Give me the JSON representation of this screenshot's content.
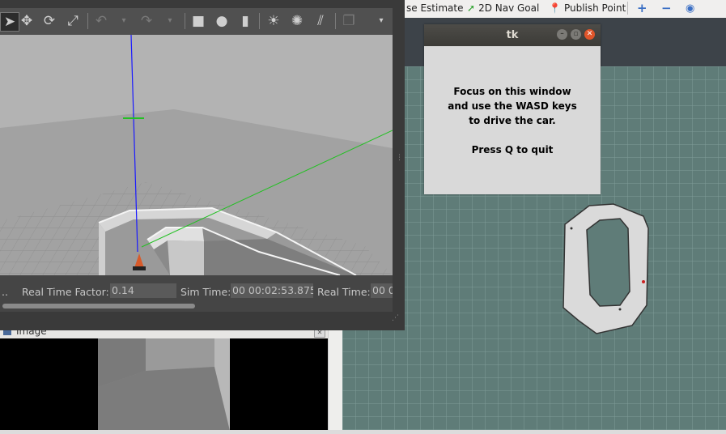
{
  "rviz": {
    "toolbar": {
      "pose_estimate_label": "se Estimate",
      "nav_goal_label": "2D Nav Goal",
      "publish_point_label": "Publish Point",
      "add_icon": "plus-icon",
      "remove_icon": "minus-icon",
      "view_icon": "eye-icon"
    },
    "grid_color": "#5f7c78",
    "track_color": "#d8d8d8"
  },
  "image_panel": {
    "title": "Image",
    "close_label": "✕"
  },
  "gazebo": {
    "toolbar": {
      "icons": [
        "select-arrow-icon",
        "translate-icon",
        "rotate-icon",
        "scale-icon",
        "undo-icon",
        "redo-icon",
        "box-icon",
        "sphere-icon",
        "cylinder-icon",
        "point-light-icon",
        "spot-light-icon",
        "directional-light-icon",
        "copy-icon"
      ]
    },
    "status": {
      "pause_label": "..",
      "real_time_factor_label": "Real Time Factor:",
      "real_time_factor_value": "0.14",
      "sim_time_label": "Sim Time:",
      "sim_time_value": "00 00:02:53.875",
      "real_time_label": "Real Time:",
      "real_time_value": "00 0"
    }
  },
  "tk": {
    "title": "tk",
    "lines": [
      "Focus on this window",
      "and use the WASD keys",
      "to drive the car.",
      "",
      "Press Q to quit"
    ],
    "close_color": "#e0552a"
  }
}
